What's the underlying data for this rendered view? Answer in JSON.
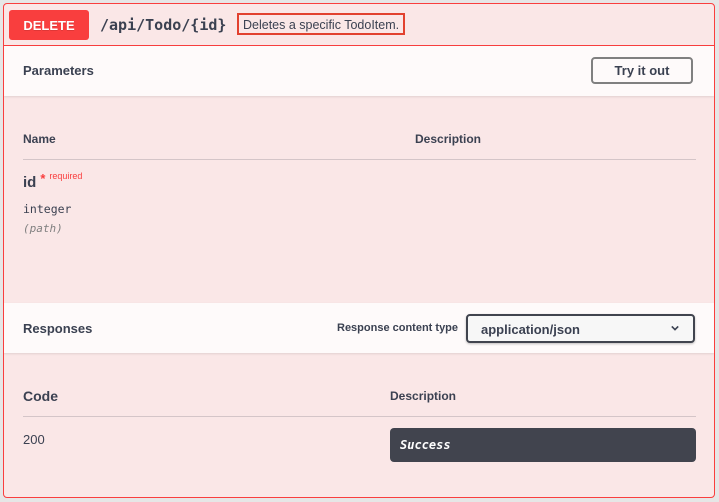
{
  "operation": {
    "method": "DELETE",
    "path": "/api/Todo/{id}",
    "summary": "Deletes a specific TodoItem.",
    "method_color": "#f93e3e"
  },
  "parameters": {
    "title": "Parameters",
    "try_button": "Try it out",
    "columns": [
      "Name",
      "Description"
    ],
    "items": [
      {
        "name": "id",
        "required_marker": "*",
        "required_label": "required",
        "type": "integer",
        "in": "(path)"
      }
    ]
  },
  "responses": {
    "title": "Responses",
    "content_type_label": "Response content type",
    "content_type_value": "application/json",
    "columns": [
      "Code",
      "Description"
    ],
    "items": [
      {
        "code": "200",
        "description": "Success"
      }
    ]
  }
}
